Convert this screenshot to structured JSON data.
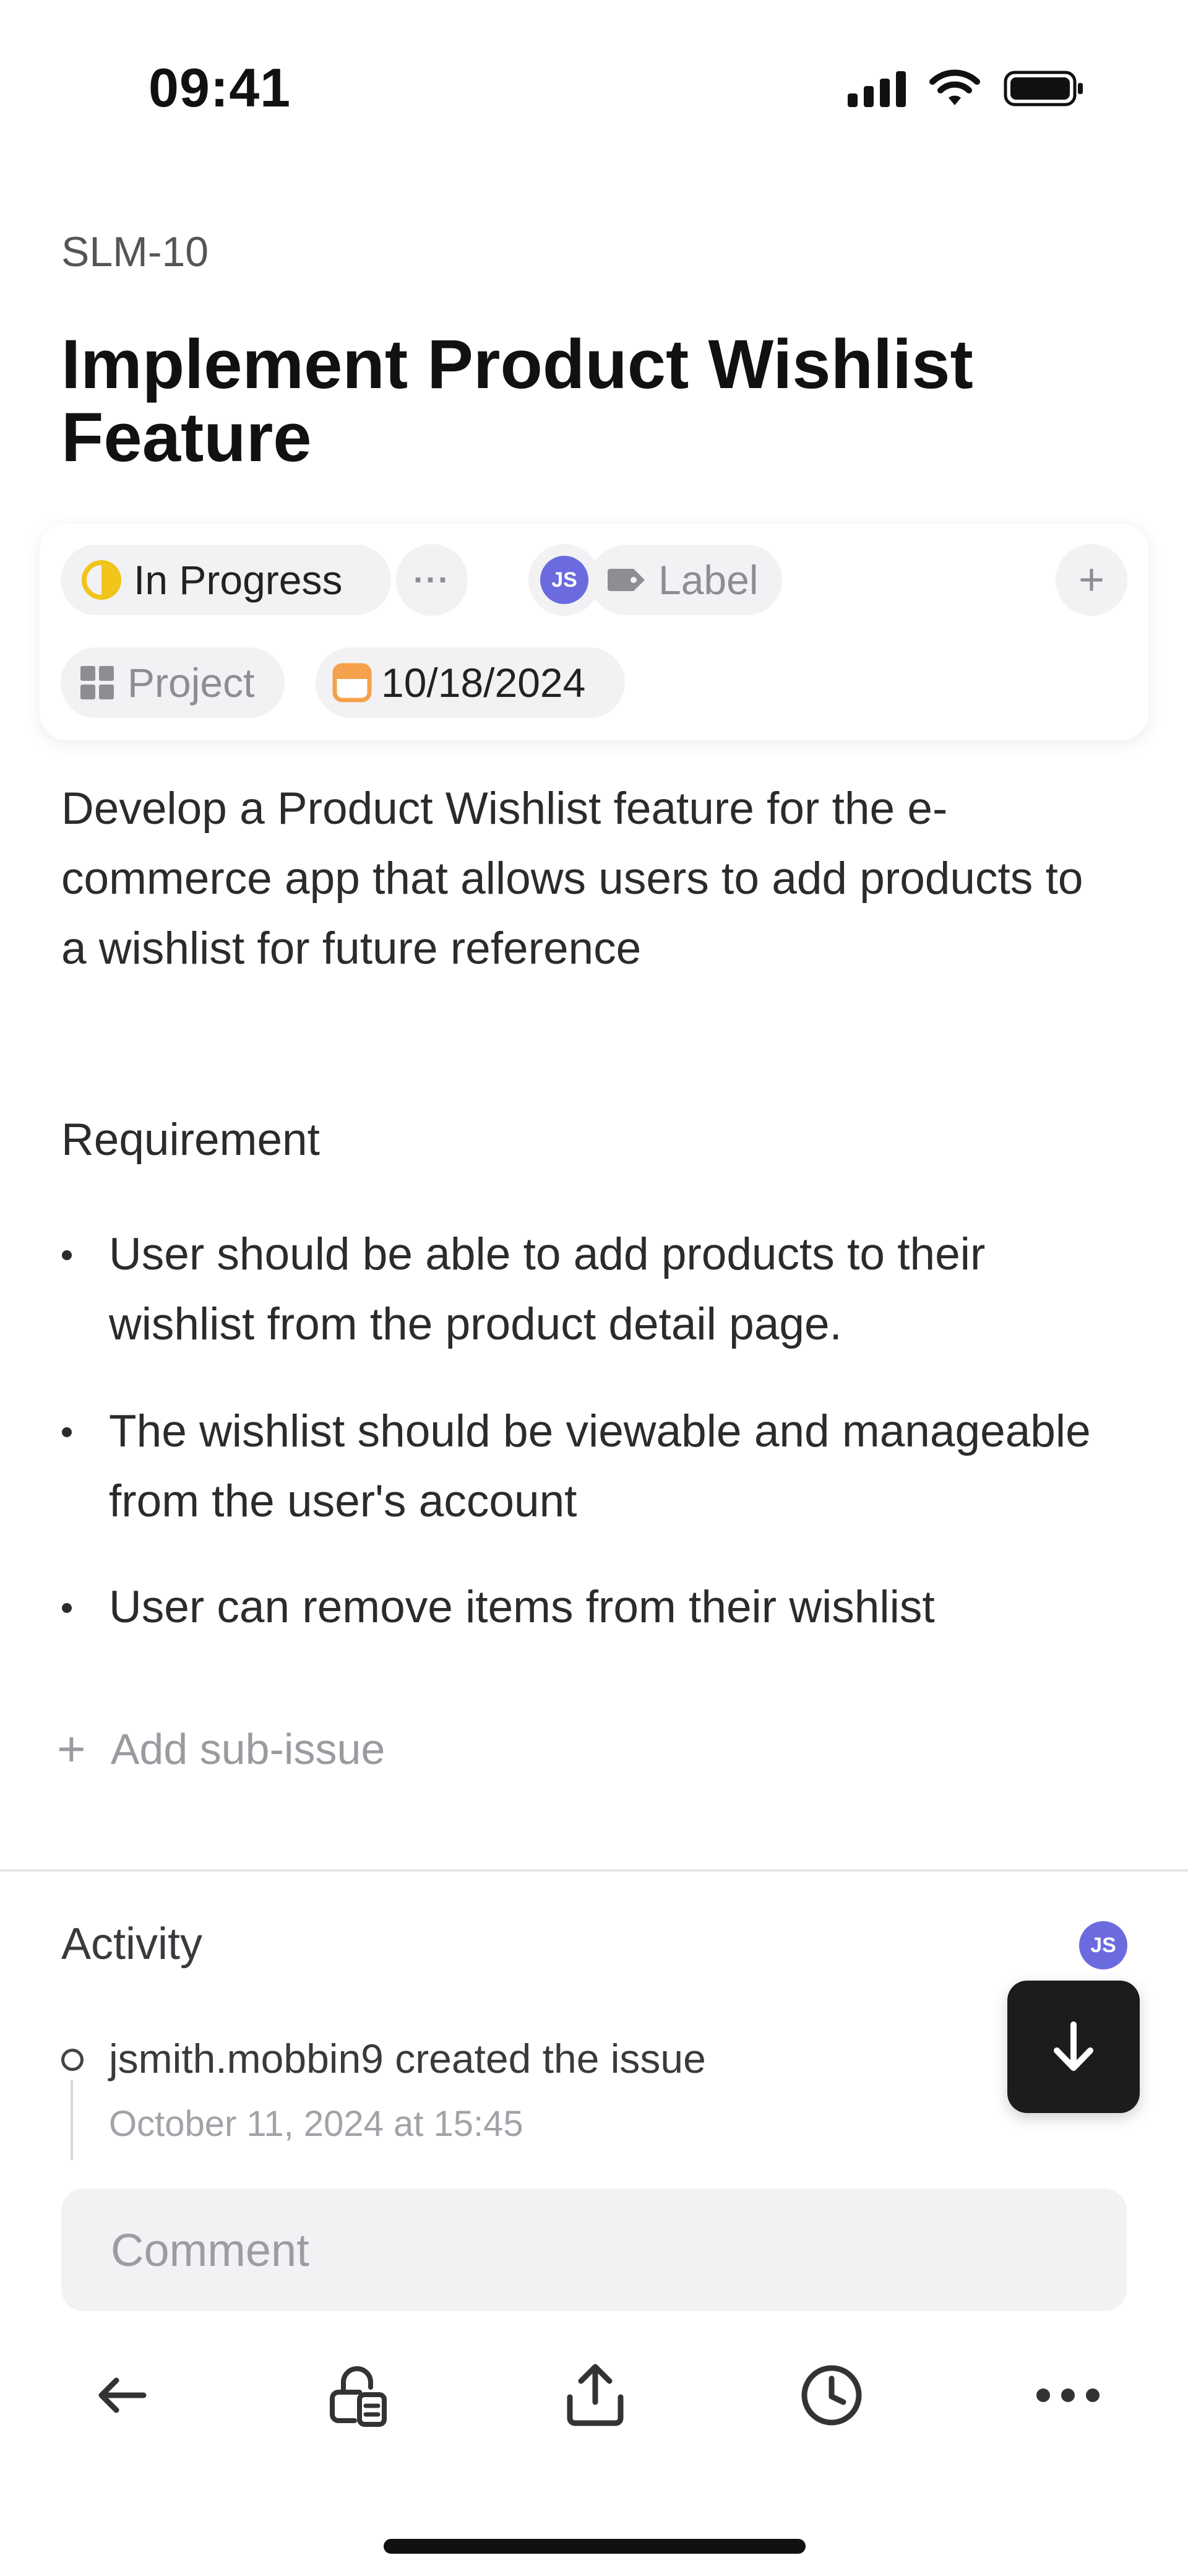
{
  "status_bar": {
    "time": "09:41"
  },
  "issue": {
    "id": "SLM-10",
    "title": "Implement Product Wishlist Feature"
  },
  "properties": {
    "status": "In Progress",
    "priority": "···",
    "assignee_initials": "JS",
    "label": "Label",
    "project": "Project",
    "due_date": "10/18/2024",
    "add": "+"
  },
  "description": {
    "text": "Develop a Product Wishlist feature for the e-commerce app that allows users to add products to a wishlist for future reference",
    "requirement_heading": "Requirement",
    "requirements": [
      "User should be able to add products to their wishlist from the product detail page.",
      "The wishlist should be viewable and manageable from the user's account",
      "User can remove items from their wishlist"
    ]
  },
  "sub_issue": {
    "plus": "+",
    "label": "Add sub-issue"
  },
  "activity": {
    "title": "Activity",
    "subscriber_initials": "JS",
    "events": [
      {
        "text": "jsmith.mobbin9 created the issue",
        "time": "October 11, 2024 at 15:45"
      }
    ]
  },
  "comment": {
    "placeholder": "Comment"
  },
  "toolbar": {
    "icons": [
      "arrow-left-icon",
      "lock-document-icon",
      "share-icon",
      "clock-icon",
      "more-icon"
    ]
  },
  "colors": {
    "status_yellow": "#f0c419",
    "avatar_purple": "#6b6bdf",
    "date_orange": "#f5a04a",
    "fab_dark": "#1c1c1e"
  }
}
